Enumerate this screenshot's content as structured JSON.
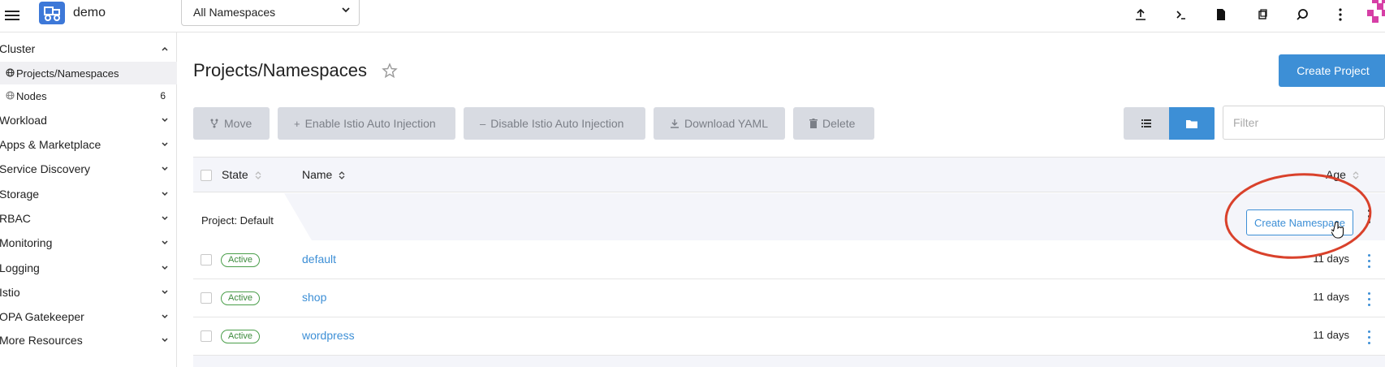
{
  "header": {
    "cluster_name": "demo",
    "namespace_selector": {
      "selected": "All Namespaces"
    },
    "icons": [
      "upload-icon",
      "terminal-icon",
      "file-icon",
      "copy-icon",
      "search-icon",
      "more-vertical-icon"
    ]
  },
  "sidebar": {
    "groups": [
      {
        "label": "Cluster",
        "expanded": true
      },
      {
        "label": "Workload"
      },
      {
        "label": "Apps & Marketplace"
      },
      {
        "label": "Service Discovery"
      },
      {
        "label": "Storage"
      },
      {
        "label": "RBAC"
      },
      {
        "label": "Monitoring"
      },
      {
        "label": "Logging"
      },
      {
        "label": "Istio"
      },
      {
        "label": "OPA Gatekeeper"
      },
      {
        "label": "More Resources"
      }
    ],
    "cluster_items": [
      {
        "label": "Projects/Namespaces",
        "active": true
      },
      {
        "label": "Nodes",
        "count": "6"
      }
    ]
  },
  "main": {
    "title": "Projects/Namespaces",
    "create_project_label": "Create Project",
    "bulk_actions": {
      "move": "Move",
      "enable_istio": "Enable Istio Auto Injection",
      "disable_istio": "Disable Istio Auto Injection",
      "download_yaml": "Download YAML",
      "delete": "Delete"
    },
    "filter_placeholder": "Filter",
    "table": {
      "columns": {
        "state": "State",
        "name": "Name",
        "age": "Age"
      },
      "group": {
        "label": "Project: Default",
        "create_namespace_label": "Create Namespace"
      },
      "rows": [
        {
          "state": "Active",
          "name": "default",
          "age": "11 days"
        },
        {
          "state": "Active",
          "name": "shop",
          "age": "11 days"
        },
        {
          "state": "Active",
          "name": "wordpress",
          "age": "11 days"
        }
      ]
    }
  },
  "colors": {
    "primary": "#3d8fd6",
    "active_badge": "#4a9e4a",
    "annotation": "#d9412b",
    "disabled_button_bg": "#d8dbe2"
  }
}
